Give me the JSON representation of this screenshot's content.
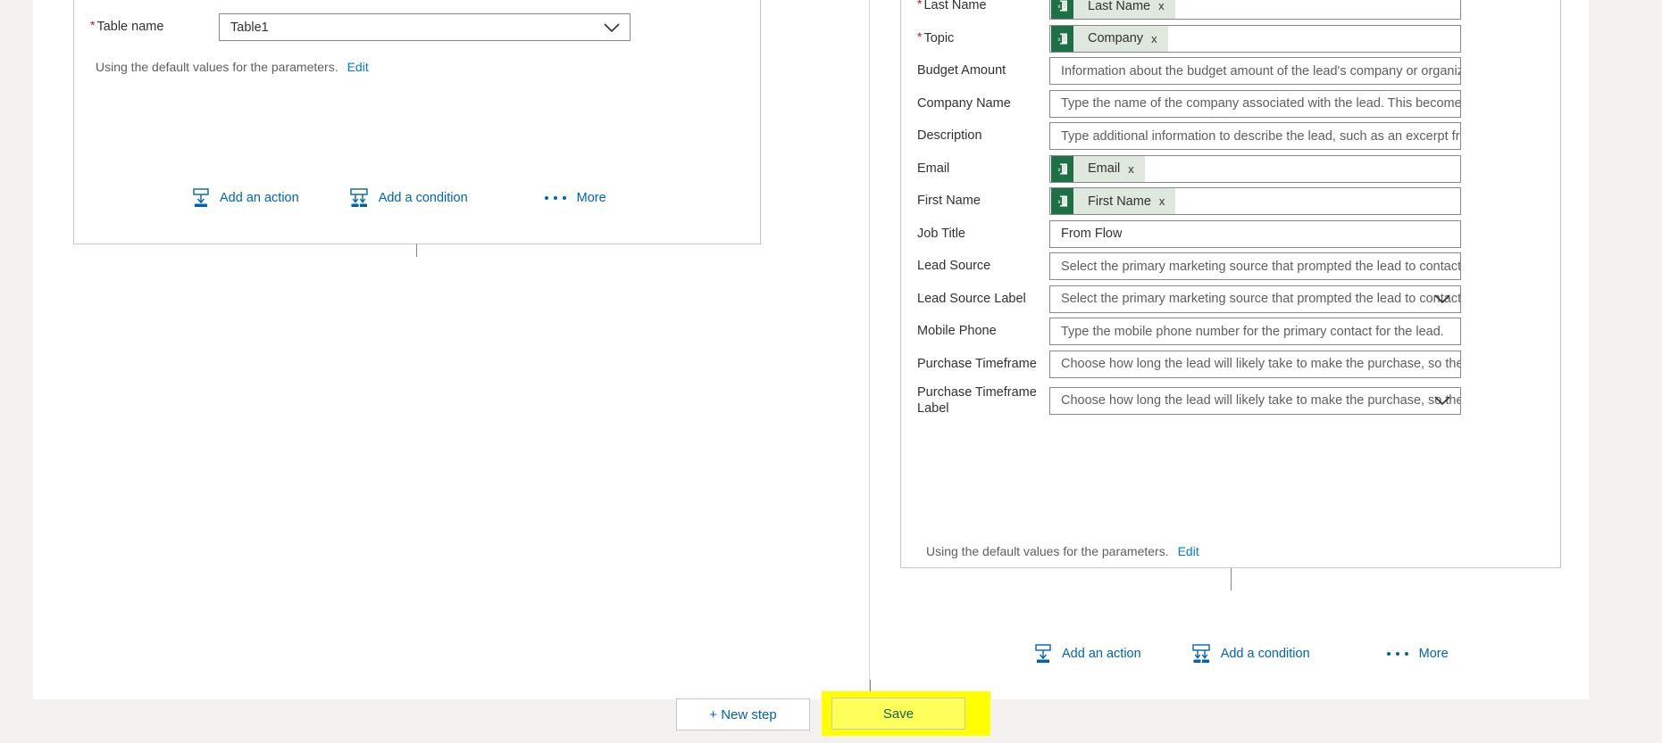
{
  "left_card": {
    "table_name": {
      "label": "Table name",
      "required": true,
      "value": "Table1",
      "icon": "chevron-down-icon"
    },
    "defaults_note": {
      "text": "Using the default values for the parameters.",
      "edit_label": "Edit"
    }
  },
  "right_card": {
    "fields": [
      {
        "label": "Last Name",
        "required": true,
        "type": "token",
        "token": {
          "text": "Last Name",
          "source_icon": "excel-icon",
          "remove_label": "x"
        }
      },
      {
        "label": "Topic",
        "required": true,
        "type": "token",
        "token": {
          "text": "Company",
          "source_icon": "excel-icon",
          "remove_label": "x"
        }
      },
      {
        "label": "Budget Amount",
        "required": false,
        "type": "text",
        "placeholder": "Information about the budget amount of the lead's company or organization."
      },
      {
        "label": "Company Name",
        "required": false,
        "type": "text",
        "placeholder": "Type the name of the company associated with the lead. This becomes the acc"
      },
      {
        "label": "Description",
        "required": false,
        "type": "text",
        "placeholder": "Type additional information to describe the lead, such as an excerpt from the"
      },
      {
        "label": "Email",
        "required": false,
        "type": "token",
        "token": {
          "text": "Email",
          "source_icon": "excel-icon",
          "remove_label": "x"
        }
      },
      {
        "label": "First Name",
        "required": false,
        "type": "token",
        "token": {
          "text": "First Name",
          "source_icon": "excel-icon",
          "remove_label": "x"
        }
      },
      {
        "label": "Job Title",
        "required": false,
        "type": "value",
        "value": "From Flow"
      },
      {
        "label": "Lead Source",
        "required": false,
        "type": "text",
        "placeholder": "Select the primary marketing source that prompted the lead to contact you."
      },
      {
        "label": "Lead Source Label",
        "required": false,
        "type": "dropdown",
        "placeholder": "Select the primary marketing source that prompted the lead to contact ",
        "icon": "chevron-down-icon"
      },
      {
        "label": "Mobile Phone",
        "required": false,
        "type": "text",
        "placeholder": "Type the mobile phone number for the primary contact for the lead."
      },
      {
        "label": "Purchase Timeframe",
        "required": false,
        "type": "text",
        "placeholder": "Choose how long the lead will likely take to make the purchase, so the sales te"
      },
      {
        "label": "Purchase Timeframe Label",
        "required": false,
        "type": "dropdown",
        "tall": true,
        "placeholder": "Choose how long the lead will likely take to make the purchase, so the s",
        "icon": "chevron-down-icon"
      }
    ],
    "defaults_note": {
      "text": "Using the default values for the parameters.",
      "edit_label": "Edit"
    }
  },
  "action_bar": {
    "add_action": {
      "label": "Add an action",
      "icon": "add-action-icon"
    },
    "add_condition": {
      "label": "Add a condition",
      "icon": "add-condition-icon"
    },
    "more": {
      "label": "More",
      "icon": "ellipsis-icon"
    }
  },
  "footer": {
    "new_step": {
      "label": "+ New step"
    },
    "save": {
      "label": "Save"
    }
  },
  "colors": {
    "link": "#0063b1",
    "required_star": "#a4262c",
    "excel_green": "#1e7145",
    "token_bg": "#dfe8df",
    "highlight_yellow": "#ffff00",
    "save_text": "#14663d",
    "page_bg": "#f3f2f1"
  }
}
